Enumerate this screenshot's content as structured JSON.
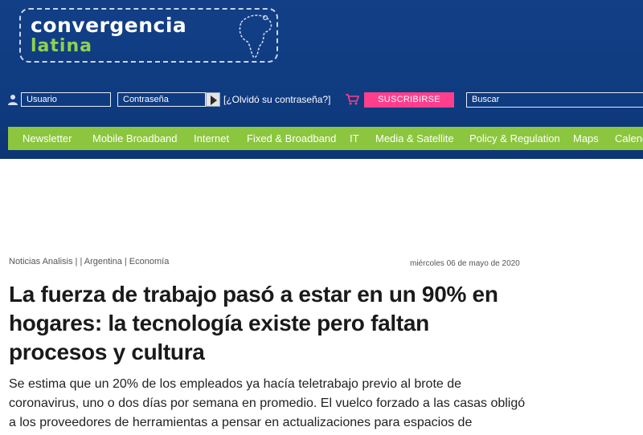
{
  "logo": {
    "line1": "Convergencia",
    "line2": "latina"
  },
  "login": {
    "username_placeholder": "Usuario",
    "password_placeholder": "Contraseña",
    "forgot_link": "[¿Olvidó su contraseña?]",
    "subscribe_label": "SUSCRIBIRSE",
    "search_placeholder": "Buscar"
  },
  "nav": {
    "items": [
      "Newsletter",
      "Mobile Broadband",
      "Internet",
      "Fixed & Broadband",
      "IT",
      "Media & Satellite",
      "Policy & Regulation",
      "Maps",
      "Calendar"
    ]
  },
  "article": {
    "meta": "Noticias Analisis | | Argentina | Economía",
    "date": "miércoles 06 de mayo de 2020",
    "title": "La fuerza de trabajo pasó a estar en un 90% en hogares: la tecnología existe pero faltan procesos y cultura",
    "summary": "Se estima que un 20% de los empleados ya hacía teletrabajo previo al brote de coronavirus, uno o dos días por semana en promedio. El vuelco forzado a las casas obligó a los proveedores de herramientas a pensar en actualizaciones para espacios de"
  },
  "colors": {
    "header_bg": "#123f86",
    "nav_bg": "#8cc63f",
    "subscribe_bg": "#ff3f8e",
    "logo_green": "#8fd14f"
  },
  "icons": [
    "user-icon",
    "arrow-right-icon",
    "cart-icon",
    "globe-icon"
  ]
}
